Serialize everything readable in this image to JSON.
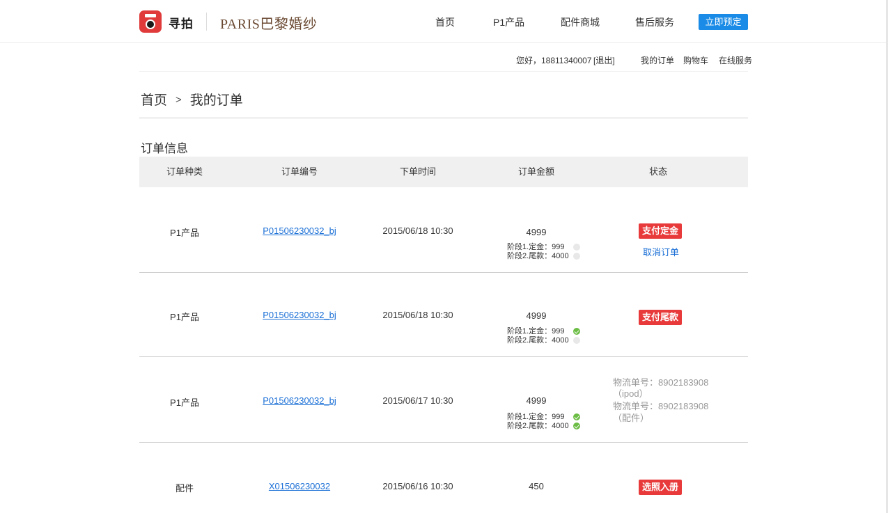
{
  "header": {
    "brand_name": "寻拍",
    "partner_logo": "PARIS巴黎婚纱",
    "nav": {
      "home": "首页",
      "p1": "P1产品",
      "accessories": "配件商城",
      "after_sales": "售后服务"
    },
    "preorder_button": "立即预定"
  },
  "userbar": {
    "greeting": "您好，18811340007",
    "logout": "[退出]",
    "my_orders": "我的订单",
    "cart": "购物车",
    "online_service": "在线服务"
  },
  "breadcrumb": {
    "home": "首页",
    "separator": ">",
    "current": "我的订单"
  },
  "section_title": "订单信息",
  "table": {
    "headers": [
      "订单种类",
      "订单编号",
      "下单时间",
      "订单金额",
      "状态"
    ],
    "rows": [
      {
        "type": "P1产品",
        "order_no": "P01506230032_bj",
        "time": "2015/06/18  10:30",
        "amount": "4999",
        "stage1": "阶段1.定金：999",
        "stage1_done": false,
        "stage2": "阶段2.尾款：4000",
        "stage2_done": false,
        "action": "支付定金",
        "secondary_action": "取消订单"
      },
      {
        "type": "P1产品",
        "order_no": "P01506230032_bj",
        "time": "2015/06/18  10:30",
        "amount": "4999",
        "stage1": "阶段1.定金：999",
        "stage1_done": true,
        "stage2": "阶段2.尾款：4000",
        "stage2_done": false,
        "action": "支付尾款"
      },
      {
        "type": "P1产品",
        "order_no": "P01506230032_bj",
        "time": "2015/06/17  10:30",
        "amount": "4999",
        "stage1": "阶段1.定金：999",
        "stage1_done": true,
        "stage2": "阶段2.尾款：4000",
        "stage2_done": true,
        "shipping": [
          "物流单号：8902183908",
          "（ipod）",
          "物流单号：8902183908",
          "（配件）"
        ]
      },
      {
        "type": "配件",
        "order_no": "X01506230032",
        "time": "2015/06/16  10:30",
        "amount": "450",
        "action": "选照入册"
      }
    ]
  },
  "colors": {
    "primary_blue": "#1a8be6",
    "link_blue": "#1a6fd6",
    "action_red": "#e83a3a",
    "done_green": "#6cbd45",
    "brand_red": "#e03a3a"
  }
}
